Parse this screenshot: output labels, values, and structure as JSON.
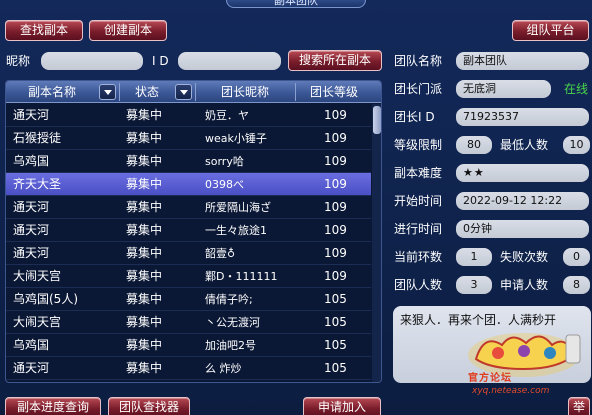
{
  "window": {
    "title": "副本团队"
  },
  "tabs": {
    "find_dungeon": "查找副本",
    "create_dungeon": "创建副本",
    "team_platform": "组队平台"
  },
  "search": {
    "nickname_label": "昵称",
    "nickname_value": "",
    "id_label": "I D",
    "id_value": "",
    "search_button": "搜索所在副本"
  },
  "list": {
    "columns": [
      "副本名称",
      "状态",
      "团长昵称",
      "团长等级"
    ],
    "selected_index": 3,
    "rows": [
      [
        "通天河",
        "募集中",
        "奶豆．ヤ",
        "109"
      ],
      [
        "石猴授徒",
        "募集中",
        "weak小锤子",
        "109"
      ],
      [
        "乌鸡国",
        "募集中",
        "sorry哈",
        "109"
      ],
      [
        "齐天大圣",
        "募集中",
        "0398べ",
        "109"
      ],
      [
        "通天河",
        "募集中",
        "所爱隔山海ざ",
        "109"
      ],
      [
        "通天河",
        "募集中",
        "一生々旅途1",
        "109"
      ],
      [
        "通天河",
        "募集中",
        "韶壹♁",
        "109"
      ],
      [
        "大闹天宫",
        "募集中",
        "鄴D・111111",
        "109"
      ],
      [
        "乌鸡国(5人)",
        "募集中",
        "倩倩子吟;",
        "105"
      ],
      [
        "大闹天宫",
        "募集中",
        "丶公无渡河",
        "105"
      ],
      [
        "乌鸡国",
        "募集中",
        "加油吧2号",
        "105"
      ],
      [
        "通天河",
        "募集中",
        "么 炸炒",
        "105"
      ]
    ]
  },
  "details": {
    "team_name_label": "团队名称",
    "team_name": "副本团队",
    "leader_school_label": "团长门派",
    "leader_school": "无底洞",
    "online_status": "在线",
    "leader_id_label": "团长I D",
    "leader_id": "71923537",
    "level_limit_label": "等级限制",
    "level_limit": "80",
    "min_members_label": "最低人数",
    "min_members": "10",
    "difficulty_label": "副本难度",
    "difficulty": "★★",
    "start_time_label": "开始时间",
    "start_time": "2022-09-12 12:22",
    "duration_label": "进行时间",
    "duration": "0分钟",
    "current_round_label": "当前环数",
    "current_round": "1",
    "fail_count_label": "失败次数",
    "fail_count": "0",
    "team_size_label": "团队人数",
    "team_size": "3",
    "applicants_label": "申请人数",
    "applicants": "8",
    "notice": "来狠人．再来个团．人满秒开"
  },
  "bottom": {
    "progress_query": "副本进度查询",
    "team_finder": "团队查找器",
    "apply_join": "申请加入",
    "report": "举"
  },
  "logo": {
    "brand_text": "官方论坛",
    "site": "xyq.netease.com"
  },
  "colors": {
    "background": "#0f234d",
    "button": "#7a1d2b",
    "selection": "#5a5fd4",
    "online": "#49d649"
  }
}
